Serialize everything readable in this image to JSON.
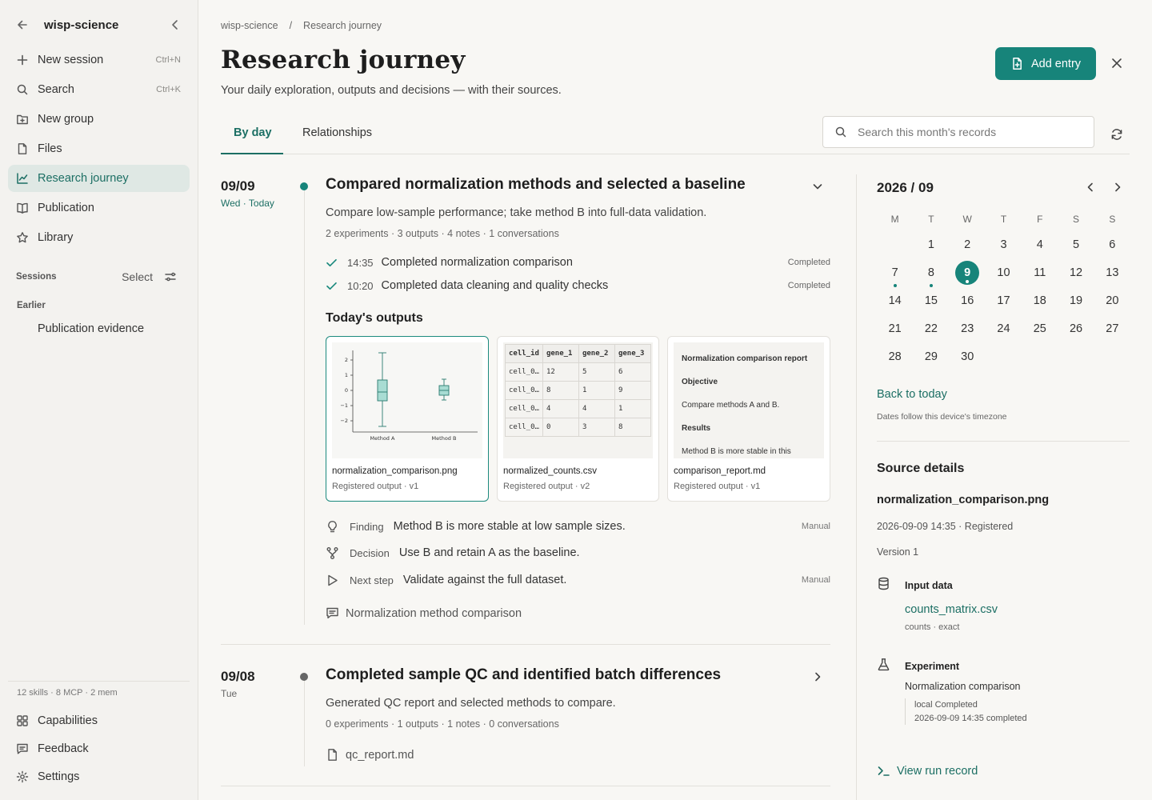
{
  "sidebar": {
    "workspace": "wisp-science",
    "nav": [
      {
        "label": "New session",
        "shortcut": "Ctrl+N",
        "icon": "plus-icon"
      },
      {
        "label": "Search",
        "shortcut": "Ctrl+K",
        "icon": "search-icon"
      },
      {
        "label": "New group",
        "icon": "folder-plus-icon"
      },
      {
        "label": "Files",
        "icon": "file-icon"
      },
      {
        "label": "Research journey",
        "icon": "chart-line-icon",
        "active": true
      },
      {
        "label": "Publication",
        "icon": "book-icon"
      },
      {
        "label": "Library",
        "icon": "star-icon"
      }
    ],
    "sessions_label": "Sessions",
    "select_label": "Select",
    "earlier_label": "Earlier",
    "session_items": [
      "Publication evidence"
    ],
    "stats": "12 skills · 8 MCP · 2 mem",
    "footer": [
      {
        "label": "Capabilities",
        "icon": "grid-icon"
      },
      {
        "label": "Feedback",
        "icon": "message-icon"
      },
      {
        "label": "Settings",
        "icon": "gear-icon"
      }
    ]
  },
  "header": {
    "breadcrumb": [
      "wisp-science",
      "/",
      "Research journey"
    ],
    "title": "Research journey",
    "subtitle": "Your daily exploration, outputs and decisions — with their sources.",
    "add_entry": "Add entry"
  },
  "tabs": [
    {
      "label": "By day",
      "active": true
    },
    {
      "label": "Relationships"
    }
  ],
  "search": {
    "placeholder": "Search this month's records"
  },
  "entries": [
    {
      "date": "09/09",
      "day": "Wed · Today",
      "title": "Compared normalization methods and selected a baseline",
      "description": "Compare low-sample performance; take method B into full-data validation.",
      "meta": "2 experiments · 3 outputs · 4 notes · 1 conversations",
      "tasks": [
        {
          "time": "14:35",
          "name": "Completed normalization comparison",
          "status": "Completed"
        },
        {
          "time": "10:20",
          "name": "Completed data cleaning and quality checks",
          "status": "Completed"
        }
      ],
      "outputs_title": "Today's outputs",
      "outputs": [
        {
          "name": "normalization_comparison.png",
          "sub": "Registered output · v1",
          "plot": {
            "yticks": [
              "2",
              "1",
              "0",
              "−1",
              "−2"
            ],
            "xlabels": [
              "Method A",
              "Method B"
            ]
          }
        },
        {
          "name": "normalized_counts.csv",
          "sub": "Registered output · v2",
          "table": [
            [
              "cell_id",
              "gene_1",
              "gene_2",
              "gene_3"
            ],
            [
              "cell_0…",
              "12",
              "5",
              "6"
            ],
            [
              "cell_0…",
              "8",
              "1",
              "9"
            ],
            [
              "cell_0…",
              "4",
              "4",
              "1"
            ],
            [
              "cell_0…",
              "0",
              "3",
              "8"
            ]
          ]
        },
        {
          "name": "comparison_report.md",
          "sub": "Registered output · v1",
          "lines": [
            "Normalization comparison report",
            "Objective",
            "Compare methods A and B.",
            "Results",
            "Method B is more stable in this"
          ]
        }
      ],
      "notes": [
        {
          "kind": "Finding",
          "text": "Method B is more stable at low sample sizes.",
          "tag": "Manual",
          "icon": "lightbulb-icon"
        },
        {
          "kind": "Decision",
          "text": "Use B and retain A as the baseline.",
          "tag": "",
          "icon": "branch-icon"
        },
        {
          "kind": "Next step",
          "text": "Validate against the full dataset.",
          "tag": "Manual",
          "icon": "play-icon"
        }
      ],
      "conversation": "Normalization method comparison"
    },
    {
      "date": "09/08",
      "day": "Tue",
      "title": "Completed sample QC and identified batch differences",
      "description": "Generated QC report and selected methods to compare.",
      "meta": "0 experiments · 1 outputs · 1 notes · 0 conversations",
      "file": "qc_report.md"
    }
  ],
  "calendar": {
    "title": "2026 / 09",
    "dow": [
      "M",
      "T",
      "W",
      "T",
      "F",
      "S",
      "S"
    ],
    "weeks": [
      [
        "",
        "1",
        "2",
        "3",
        "4",
        "5",
        "6"
      ],
      [
        "7",
        "8",
        "9",
        "10",
        "11",
        "12",
        "13"
      ],
      [
        "14",
        "15",
        "16",
        "17",
        "18",
        "19",
        "20"
      ],
      [
        "21",
        "22",
        "23",
        "24",
        "25",
        "26",
        "27"
      ],
      [
        "28",
        "29",
        "30",
        "",
        "",
        "",
        ""
      ]
    ],
    "today": "9",
    "marked": [
      "7",
      "8",
      "9"
    ],
    "back_today": "Back to today",
    "tz_note": "Dates follow this device's timezone"
  },
  "source": {
    "title": "Source details",
    "file": "normalization_comparison.png",
    "registered": "2026-09-09 14:35 · Registered",
    "version": "Version 1",
    "input_label": "Input data",
    "input_file": "counts_matrix.csv",
    "input_sub": "counts · exact",
    "experiment_label": "Experiment",
    "experiment_name": "Normalization comparison",
    "experiment_status": "local Completed",
    "experiment_time": "2026-09-09 14:35 completed",
    "view_run": "View run record"
  },
  "colors": {
    "accent": "#17847a",
    "accent_text": "#1c6f64",
    "active_bg": "#dfe8e4"
  }
}
